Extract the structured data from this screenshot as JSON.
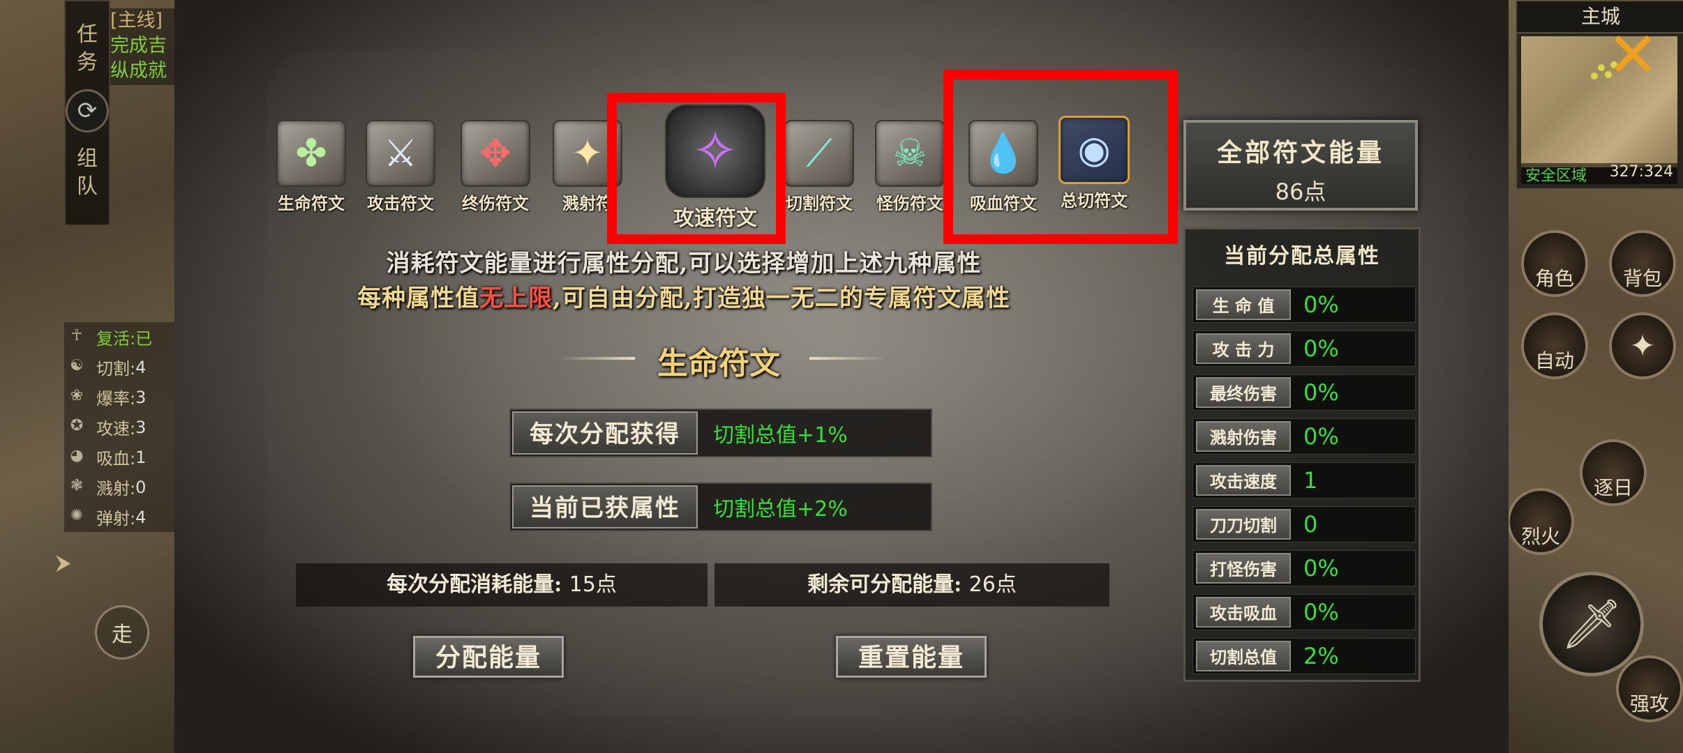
{
  "quest": {
    "tab_chars": [
      "任",
      "务"
    ],
    "team_chars": [
      "组",
      "队"
    ],
    "tag": "[主线]",
    "lines": [
      "完成吉",
      "纵成就"
    ]
  },
  "left_stats": [
    {
      "label": "复活:",
      "value": "已",
      "green": true,
      "icon": "revive-icon"
    },
    {
      "label": "切割:",
      "value": "4",
      "green": false,
      "icon": "cut-icon"
    },
    {
      "label": "爆率:",
      "value": "3",
      "green": false,
      "icon": "drop-rate-icon"
    },
    {
      "label": "攻速:",
      "value": "3",
      "green": false,
      "icon": "attack-speed-icon"
    },
    {
      "label": "吸血:",
      "value": "1",
      "green": false,
      "icon": "lifesteal-icon"
    },
    {
      "label": "溅射:",
      "value": "0",
      "green": false,
      "icon": "splash-icon"
    },
    {
      "label": "弹射:",
      "value": "4",
      "green": false,
      "icon": "bounce-icon"
    }
  ],
  "walk_label": "走",
  "minimap": {
    "title": "主城",
    "safe_zone": "安全区域",
    "coords": "327:324"
  },
  "hud_buttons": {
    "character": "角色",
    "bag": "背包",
    "auto": "自动",
    "skill": "烈火",
    "attack2": "逐日",
    "strong_attack": "强攻"
  },
  "rune_tabs": [
    {
      "label": "生命符文",
      "icon": "life-rune-icon",
      "glyph": "✤",
      "color": "#b9f0a0"
    },
    {
      "label": "攻击符文",
      "icon": "attack-rune-icon",
      "glyph": "⚔",
      "color": "#dfe8ff"
    },
    {
      "label": "终伤符文",
      "icon": "final-damage-rune-icon",
      "glyph": "✥",
      "color": "#ff6a6a"
    },
    {
      "label": "溅射符",
      "icon": "splash-rune-icon",
      "glyph": "✦",
      "color": "#ffe7a8"
    },
    {
      "label": "攻速符文",
      "icon": "attack-speed-rune-icon",
      "glyph": "✧",
      "color": "#d070ff"
    },
    {
      "label": "切割符文",
      "icon": "cut-rune-icon",
      "glyph": "⟋",
      "color": "#7ff0e0"
    },
    {
      "label": "怪伤符文",
      "icon": "monster-damage-rune-icon",
      "glyph": "☠",
      "color": "#7ff0c0"
    },
    {
      "label": "吸血符文",
      "icon": "lifesteal-rune-icon",
      "glyph": "💧",
      "color": "#ff5070"
    },
    {
      "label": "总切符文",
      "icon": "total-cut-rune-icon",
      "glyph": "◉",
      "color": "#bfe0ff"
    }
  ],
  "energy": {
    "title": "全部符文能量",
    "value": "86点"
  },
  "attr_panel": {
    "title": "当前分配总属性",
    "rows": [
      {
        "label": "生 命 值",
        "value": "0%"
      },
      {
        "label": "攻 击 力",
        "value": "0%"
      },
      {
        "label": "最终伤害",
        "value": "0%"
      },
      {
        "label": "溅射伤害",
        "value": "0%"
      },
      {
        "label": "攻击速度",
        "value": "1"
      },
      {
        "label": "刀刀切割",
        "value": "0"
      },
      {
        "label": "打怪伤害",
        "value": "0%"
      },
      {
        "label": "攻击吸血",
        "value": "0%"
      },
      {
        "label": "切割总值",
        "value": "2%"
      }
    ]
  },
  "description": {
    "line1": "消耗符文能量进行属性分配,可以选择增加上述九种属性",
    "line2_a": "每种属性值",
    "line2_red": "无上限",
    "line2_b": ",可自由分配,打造独一无二的专属符文属性"
  },
  "section_title": "生命符文",
  "per_alloc": {
    "label": "每次分配获得",
    "value": "切割总值+1%"
  },
  "current_attr": {
    "label": "当前已获属性",
    "value": "切割总值+2%"
  },
  "cost": {
    "label": "每次分配消耗能量:",
    "value": "15点"
  },
  "remaining": {
    "label": "剩余可分配能量:",
    "value": "26点"
  },
  "buttons": {
    "allocate": "分配能量",
    "reset": "重置能量"
  },
  "colors": {
    "highlight": "#ff0000",
    "value_green": "#39e03a",
    "title_gold": "#f5d178"
  }
}
